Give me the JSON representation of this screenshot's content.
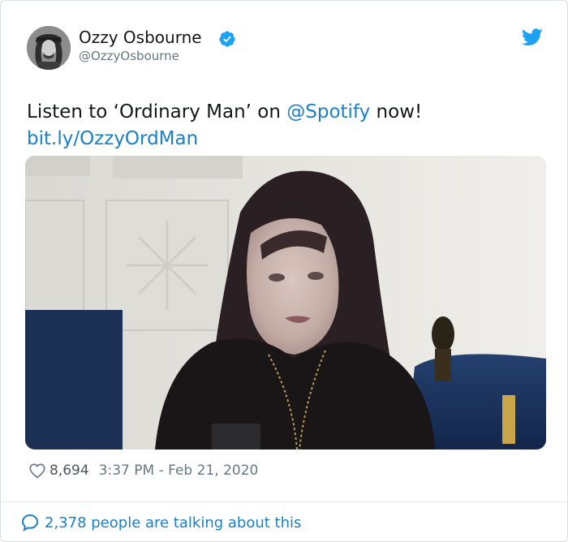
{
  "author": {
    "display_name": "Ozzy Osbourne",
    "handle": "@OzzyOsbourne",
    "verified": true,
    "avatar_icon": "avatar-photo"
  },
  "tweet": {
    "text_prefix": "Listen to ‘Ordinary Man’ on ",
    "mention": "@Spotify",
    "text_suffix": " now!",
    "link": "bit.ly/OzzyOrdMan"
  },
  "media": {
    "type": "image",
    "icon": "photo-of-ozzy-osbourne"
  },
  "meta": {
    "like_count": "8,694",
    "time": "3:37 PM",
    "separator": " - ",
    "date": "Feb 21, 2020"
  },
  "footer": {
    "talking_text": "2,378 people are talking about this"
  },
  "colors": {
    "link": "#1b7fc6",
    "twitter_blue": "#1da1f2",
    "text": "#14171a",
    "muted": "#657786"
  }
}
